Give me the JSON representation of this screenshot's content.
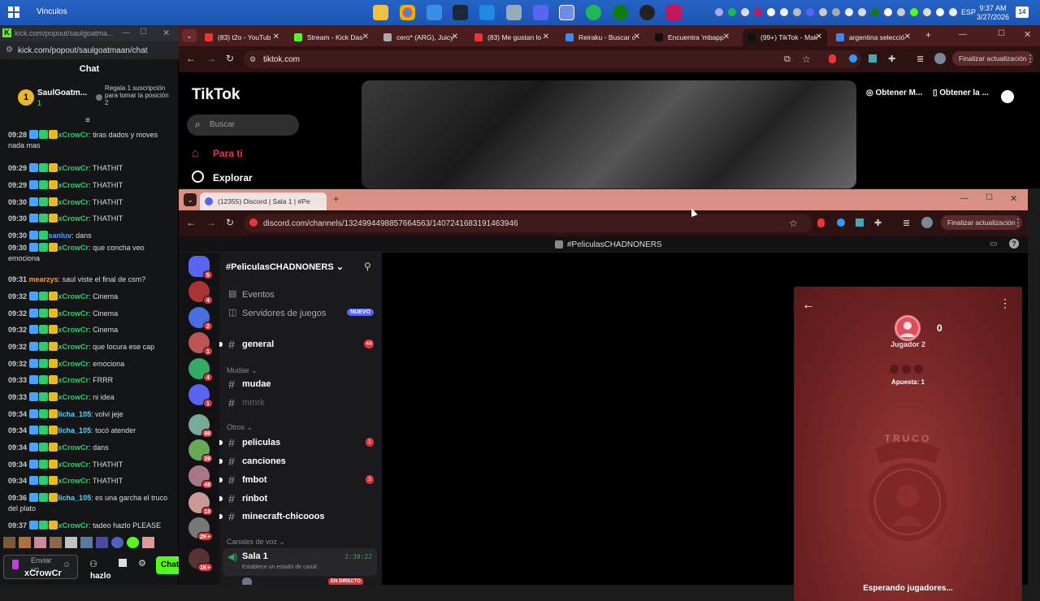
{
  "taskbar": {
    "window_title": "Vinculos",
    "time": "9:37 AM",
    "date": "3/27/2026",
    "lang": "ESP",
    "notif_count": "14"
  },
  "kick": {
    "window_title": "kick.com/popout/saulgoatma...",
    "url": "kick.com/popout/saulgoatmaan/chat",
    "chat_title": "Chat",
    "pinned_user": "SaulGoatm...",
    "pinned_sub": "1",
    "pinned_rank": "1",
    "pinned_note": "Regala 1 suscripción para tomar la posición 2",
    "messages": [
      {
        "time": "09:28",
        "user": "xCrowCr",
        "text": "tiras dados y moves nada mas",
        "color": "#2ecc71"
      },
      {
        "time": "09:29",
        "user": "xCrowCr",
        "text": "THATHIT",
        "color": "#2ecc71"
      },
      {
        "time": "09:29",
        "user": "xCrowCr",
        "text": "THATHIT",
        "color": "#2ecc71"
      },
      {
        "time": "09:30",
        "user": "xCrowCr",
        "text": "THATHIT",
        "color": "#2ecc71"
      },
      {
        "time": "09:30",
        "user": "xCrowCr",
        "text": "THATHIT",
        "color": "#2ecc71"
      },
      {
        "time": "09:30",
        "user": "sanluv",
        "text": "dans",
        "color": "#4aa3ff"
      },
      {
        "time": "09:30",
        "user": "xCrowCr",
        "text": "que concha veo emociona",
        "color": "#2ecc71"
      },
      {
        "time": "09:31",
        "user": "mearzys",
        "text": "saul viste el final de csm?",
        "color": "#e8a04a"
      },
      {
        "time": "09:32",
        "user": "xCrowCr",
        "text": "Cinema",
        "color": "#2ecc71"
      },
      {
        "time": "09:32",
        "user": "xCrowCr",
        "text": "Cinema",
        "color": "#2ecc71"
      },
      {
        "time": "09:32",
        "user": "xCrowCr",
        "text": "Cinema",
        "color": "#2ecc71"
      },
      {
        "time": "09:32",
        "user": "xCrowCr",
        "text": "que locura ese cap",
        "color": "#2ecc71"
      },
      {
        "time": "09:32",
        "user": "xCrowCr",
        "text": "emociona",
        "color": "#2ecc71"
      },
      {
        "time": "09:33",
        "user": "xCrowCr",
        "text": "FRRR",
        "color": "#2ecc71"
      },
      {
        "time": "09:33",
        "user": "xCrowCr",
        "text": "ni idea",
        "color": "#2ecc71"
      },
      {
        "time": "09:34",
        "user": "licha_105",
        "text": "volvi jeje",
        "color": "#4ad9ff"
      },
      {
        "time": "09:34",
        "user": "licha_105",
        "text": "tocó atender",
        "color": "#4ad9ff"
      },
      {
        "time": "09:34",
        "user": "xCrowCr",
        "text": "dans",
        "color": "#2ecc71"
      },
      {
        "time": "09:34",
        "user": "xCrowCr",
        "text": "THATHIT",
        "color": "#2ecc71"
      },
      {
        "time": "09:34",
        "user": "xCrowCr",
        "text": "THATHIT",
        "color": "#2ecc71"
      },
      {
        "time": "09:36",
        "user": "licha_105",
        "text": "es una garcha el truco del plato",
        "color": "#4ad9ff"
      },
      {
        "time": "09:37",
        "user": "xCrowCr",
        "text": "tadeo hazlo PLEASE",
        "color": "#2ecc71"
      }
    ],
    "input_placeholder": "Enviar un",
    "send_label": "Chat",
    "overlay_user": "xCrowCr",
    "overlay_text": "hazlo"
  },
  "tiktok": {
    "tabs": [
      {
        "label": "(83) t2o - YouTub",
        "color": "#e33"
      },
      {
        "label": "Stream - Kick Das",
        "color": "#53fc18"
      },
      {
        "label": "cero* (ARG), Juicy",
        "color": "#aaa"
      },
      {
        "label": "(83) Me gustan lo",
        "color": "#e33"
      },
      {
        "label": "Reiraku - Buscar c",
        "color": "#4285f4"
      },
      {
        "label": "Encuentra 'mbapp",
        "color": "#111"
      },
      {
        "label": "(99+) TikTok - Mak",
        "color": "#111"
      },
      {
        "label": "argentina selecció",
        "color": "#4285f4"
      }
    ],
    "url": "tiktok.com",
    "update_label": "Finalizar actualización",
    "logo": "TikTok",
    "search_placeholder": "Buscar",
    "nav_foryou": "Para ti",
    "nav_explore": "Explorar",
    "get_app1": "Obtener M...",
    "get_app2": "Obtener la ..."
  },
  "discord": {
    "tab_label": "(12355) Discord | Sala 1 | #Pe",
    "url": "discord.com/channels/1324994498857664563/1407241683191463946",
    "update_label": "Finalizar actualización",
    "header_title": "#PeliculasCHADNONERS",
    "guild_name": "#PeliculasCHADNONERS",
    "events": "Eventos",
    "game_servers": "Servidores de juegos",
    "new_badge": "NUEVO",
    "server_badges": [
      "5",
      "4",
      "2",
      "1",
      "4",
      "1",
      "98",
      "39",
      "48",
      "18",
      "2K+",
      "1K+"
    ],
    "categories": {
      "mudae": "Mudae",
      "otros": "Otros",
      "voice": "Canales de voz"
    },
    "channels": [
      {
        "name": "general",
        "count": "44"
      },
      {
        "name": "mudae",
        "count": ""
      },
      {
        "name": "mmrk",
        "count": ""
      },
      {
        "name": "peliculas",
        "count": "1"
      },
      {
        "name": "canciones",
        "count": ""
      },
      {
        "name": "fmbot",
        "count": "3"
      },
      {
        "name": "rinbot",
        "count": ""
      },
      {
        "name": "minecraft-chicooos",
        "count": ""
      }
    ],
    "voice_channel": "Sala 1",
    "voice_time": "2:30:22",
    "voice_status": "Establece un estado de canal",
    "live_badge": "EN DIRECTO",
    "game": {
      "player": "Jugador 2",
      "score": "0",
      "bet": "Apuesta: 1",
      "crest_text": "TRUCO",
      "waiting": "Esperando jugadores..."
    }
  }
}
